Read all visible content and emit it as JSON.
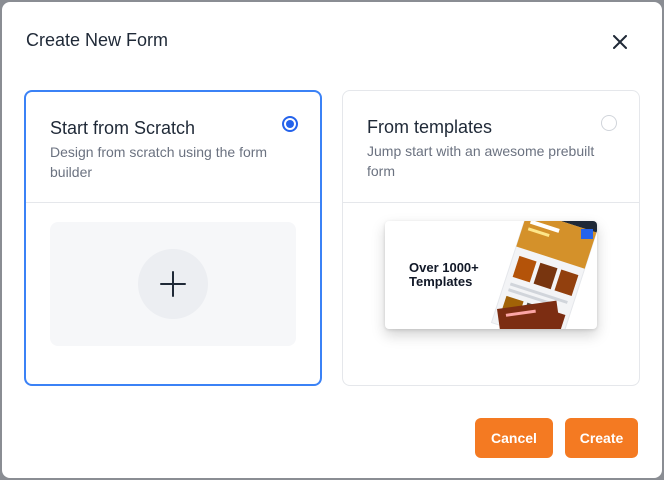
{
  "modal": {
    "title": "Create New Form"
  },
  "options": {
    "scratch": {
      "title": "Start from Scratch",
      "description": "Design from scratch using the form builder",
      "selected": true
    },
    "templates": {
      "title": "From templates",
      "description": "Jump start with an awesome prebuilt form",
      "selected": false,
      "preview_text": "Over 1000+\nTemplates"
    }
  },
  "footer": {
    "cancel_label": "Cancel",
    "create_label": "Create"
  },
  "colors": {
    "accent": "#f47a22",
    "selected_border": "#3b82f6"
  },
  "icons": {
    "close": "close-icon",
    "add": "plus-icon"
  }
}
